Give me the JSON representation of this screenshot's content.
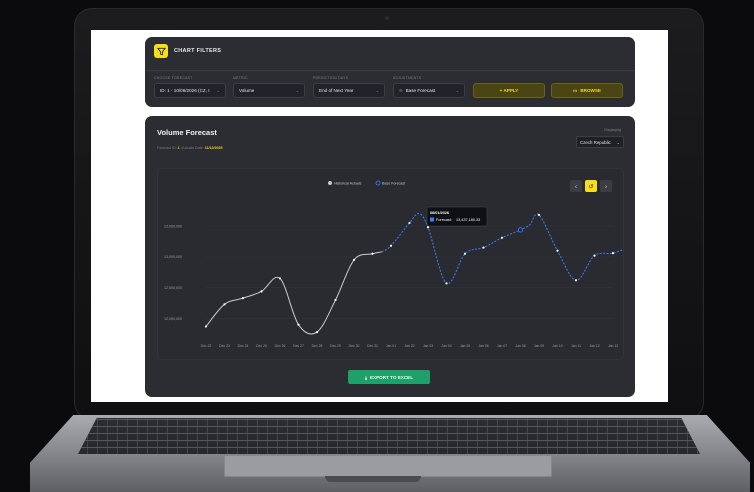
{
  "filters": {
    "title": "CHART FILTERS",
    "fields": [
      {
        "label": "CHOOSE FORECAST",
        "value": "ID: 1 - 10/06/2026 (CZ, I"
      },
      {
        "label": "METRIC",
        "value": "Volume"
      },
      {
        "label": "PREDICTION DAYS",
        "value": "End of Next Year"
      },
      {
        "label": "ADJUSTMENTS",
        "value": "Base Forecast"
      }
    ],
    "apply_label": "+ APPLY",
    "browse_label": "BROWSE"
  },
  "main": {
    "title": "Volume Forecast",
    "sub_prefix": "Forecast ID:",
    "forecast_id": "1",
    "sub_sep": "| Actuals Date:",
    "actuals_date": "11/12/2025",
    "displaying_label": "Displaying",
    "country": "Czech Republic",
    "export_label": "EXPORT TO EXCEL"
  },
  "tooltip": {
    "date": "08/01/2026",
    "label": "Forecast:",
    "value": "13,437,180.33"
  },
  "colors": {
    "accent": "#f6dd1d",
    "historical": "#c9c9ce",
    "forecast": "#3f7fff",
    "export": "#1fa06a"
  },
  "chart_data": {
    "type": "line",
    "legend": [
      "Historical Actuals",
      "Base Forecast"
    ],
    "legend_position": "top-center",
    "categories": [
      "Dec 22",
      "Dec 23",
      "Dec 24",
      "Dec 25",
      "Dec 26",
      "Dec 27",
      "Dec 28",
      "Dec 29",
      "Dec 30",
      "Dec 31",
      "Jan 01",
      "Jan 02",
      "Jan 03",
      "Jan 04",
      "Jan 05",
      "Jan 06",
      "Jan 07",
      "Jan 08",
      "Jan 09",
      "Jan 10",
      "Jan 11",
      "Jan 12",
      "Jan 13"
    ],
    "y_ticks": [
      "12,000,000",
      "12,500,000",
      "13,000,000",
      "13,500,000"
    ],
    "ylim": [
      11700000,
      14100000
    ],
    "series": [
      {
        "name": "Historical Actuals",
        "x": [
          0,
          1,
          2,
          3,
          4,
          5,
          6,
          7,
          8,
          9,
          9.5
        ],
        "values": [
          11870000,
          12230000,
          12330000,
          12440000,
          12650000,
          11900000,
          11780000,
          12300000,
          12950000,
          13050000,
          13080000
        ]
      },
      {
        "name": "Base Forecast",
        "x": [
          9.5,
          10,
          11,
          11.5,
          12,
          13,
          14,
          15,
          16,
          17,
          17.5,
          18,
          19,
          20,
          21,
          22,
          23
        ],
        "values": [
          13080000,
          13180000,
          13550000,
          13700000,
          13480000,
          12570000,
          13050000,
          13150000,
          13310000,
          13437180.33,
          13520000,
          13680000,
          13100000,
          12620000,
          13020000,
          13060000,
          13170000
        ]
      }
    ],
    "grid": true
  }
}
